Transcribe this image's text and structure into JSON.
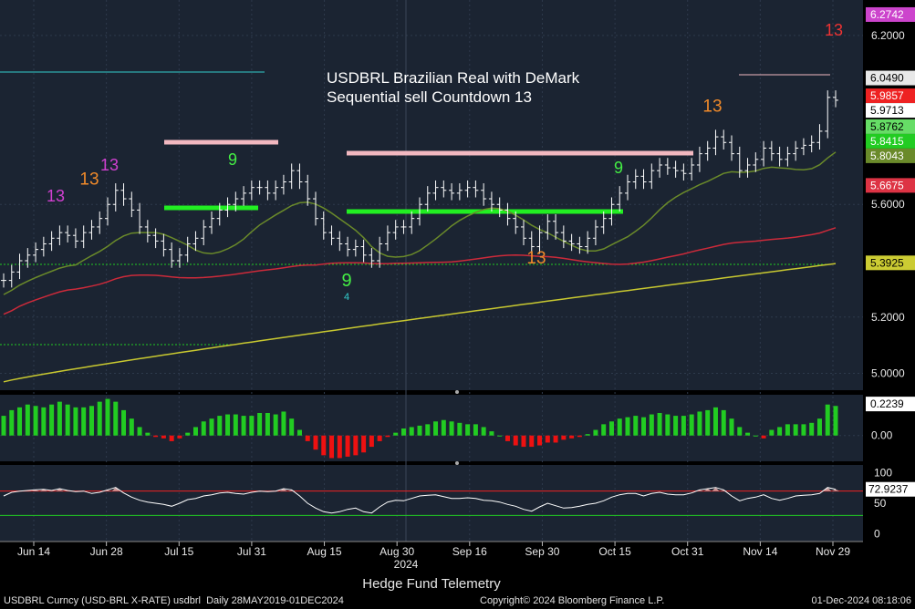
{
  "chart_data": {
    "type": "candlestick",
    "title": "USDBRL Brazilian Real with DeMark\nSequential sell Countdown 13",
    "year_label": "2024",
    "x_tick_labels": [
      "Jun 14",
      "Jun 28",
      "Jul 15",
      "Jul 31",
      "Aug 15",
      "Aug 30",
      "Sep 16",
      "Sep 30",
      "Oct 15",
      "Oct 31",
      "Nov 14",
      "Nov 29"
    ],
    "price_panel": {
      "ylim": [
        4.95,
        6.3
      ],
      "y_ticks": [
        "6.2000",
        "5.6000",
        "5.2000",
        "5.0000"
      ],
      "y_tick_values": [
        6.2,
        5.6,
        5.2,
        5.0
      ],
      "last_price_labels": [
        {
          "text": "6.2742",
          "value": 6.2742,
          "color": "#cc44cc"
        },
        {
          "text": "6.0490",
          "value": 6.049,
          "color": "#e8e8e8"
        },
        {
          "text": "5.9857",
          "value": 5.9857,
          "color": "#ee2222"
        },
        {
          "text": "5.9713",
          "value": 5.9713,
          "color": "#ffffff"
        },
        {
          "text": "5.8762",
          "value": 5.8762,
          "color": "#66dd66"
        },
        {
          "text": "5.8415",
          "value": 5.8415,
          "color": "#22cc22"
        },
        {
          "text": "5.8043",
          "value": 5.8043,
          "color": "#6a8a2a"
        },
        {
          "text": "5.6675",
          "value": 5.6675,
          "color": "#dd3344"
        },
        {
          "text": "5.3925",
          "value": 5.3925,
          "color": "#cccc33"
        }
      ],
      "closes": [
        5.33,
        5.36,
        5.4,
        5.42,
        5.44,
        5.46,
        5.48,
        5.5,
        5.49,
        5.47,
        5.5,
        5.52,
        5.55,
        5.6,
        5.65,
        5.62,
        5.58,
        5.52,
        5.49,
        5.47,
        5.44,
        5.4,
        5.42,
        5.46,
        5.48,
        5.52,
        5.55,
        5.58,
        5.6,
        5.62,
        5.64,
        5.66,
        5.66,
        5.64,
        5.66,
        5.68,
        5.72,
        5.68,
        5.62,
        5.55,
        5.5,
        5.48,
        5.46,
        5.44,
        5.45,
        5.42,
        5.4,
        5.46,
        5.5,
        5.52,
        5.52,
        5.55,
        5.6,
        5.64,
        5.66,
        5.65,
        5.64,
        5.65,
        5.66,
        5.65,
        5.62,
        5.6,
        5.58,
        5.55,
        5.52,
        5.48,
        5.45,
        5.5,
        5.54,
        5.5,
        5.47,
        5.46,
        5.45,
        5.48,
        5.52,
        5.55,
        5.6,
        5.64,
        5.68,
        5.7,
        5.68,
        5.72,
        5.74,
        5.73,
        5.72,
        5.71,
        5.74,
        5.78,
        5.8,
        5.84,
        5.82,
        5.78,
        5.72,
        5.74,
        5.76,
        5.8,
        5.78,
        5.76,
        5.78,
        5.8,
        5.81,
        5.82,
        5.86,
        5.98,
        5.97
      ],
      "demark_counts": [
        {
          "text": "13",
          "color": "#d040d0",
          "value": 5.61
        },
        {
          "text": "13",
          "color": "#f08a2a",
          "value": 5.67
        },
        {
          "text": "13",
          "color": "#d040d0",
          "value": 5.72
        },
        {
          "text": "9",
          "color": "#44ee44",
          "value": 5.74
        },
        {
          "text": "9",
          "color": "#44ee44",
          "value": 5.31
        },
        {
          "text": "4",
          "color": "#33cccc",
          "value": 5.26
        },
        {
          "text": "13",
          "color": "#f08a2a",
          "value": 5.39
        },
        {
          "text": "9",
          "color": "#44ee44",
          "value": 5.71
        },
        {
          "text": "13",
          "color": "#f08a2a",
          "value": 5.93
        },
        {
          "text": "13",
          "color": "#ee3333",
          "value": 6.2
        }
      ]
    },
    "macd_panel": {
      "ylim": [
        -0.17,
        0.27
      ],
      "y_ticks": [
        "0.00"
      ],
      "y_tick_values": [
        0
      ],
      "last_label": {
        "text": "0.2239",
        "value": 0.2239
      },
      "values": [
        0.14,
        0.18,
        0.2,
        0.22,
        0.21,
        0.2,
        0.22,
        0.24,
        0.22,
        0.2,
        0.2,
        0.21,
        0.24,
        0.26,
        0.24,
        0.18,
        0.12,
        0.06,
        0.02,
        -0.01,
        -0.02,
        -0.04,
        -0.02,
        0.02,
        0.06,
        0.1,
        0.12,
        0.14,
        0.15,
        0.15,
        0.14,
        0.14,
        0.16,
        0.16,
        0.15,
        0.17,
        0.12,
        0.04,
        -0.04,
        -0.1,
        -0.14,
        -0.16,
        -0.16,
        -0.15,
        -0.14,
        -0.12,
        -0.08,
        -0.04,
        -0.01,
        0.02,
        0.05,
        0.06,
        0.07,
        0.08,
        0.1,
        0.11,
        0.1,
        0.09,
        0.08,
        0.08,
        0.06,
        0.03,
        0.0,
        -0.04,
        -0.07,
        -0.08,
        -0.08,
        -0.07,
        -0.05,
        -0.05,
        -0.03,
        -0.02,
        -0.01,
        0.01,
        0.04,
        0.08,
        0.1,
        0.12,
        0.13,
        0.14,
        0.13,
        0.15,
        0.16,
        0.15,
        0.14,
        0.14,
        0.15,
        0.17,
        0.18,
        0.2,
        0.18,
        0.12,
        0.06,
        0.02,
        0.0,
        -0.02,
        0.04,
        0.06,
        0.08,
        0.08,
        0.08,
        0.09,
        0.12,
        0.22,
        0.21
      ]
    },
    "rsi_panel": {
      "ylim": [
        -10,
        110
      ],
      "y_ticks": [
        "100",
        "50",
        "0"
      ],
      "y_tick_values": [
        100,
        50,
        0
      ],
      "overbought": 70,
      "oversold": 30,
      "last_label": {
        "text": "72.9237",
        "value": 72.9237
      },
      "values": [
        62,
        68,
        70,
        71,
        72,
        73,
        71,
        74,
        71,
        69,
        70,
        66,
        68,
        72,
        76,
        67,
        60,
        55,
        52,
        50,
        48,
        45,
        50,
        56,
        58,
        62,
        64,
        67,
        68,
        66,
        65,
        68,
        70,
        69,
        70,
        74,
        72,
        62,
        50,
        42,
        36,
        34,
        36,
        40,
        42,
        36,
        34,
        44,
        52,
        55,
        54,
        58,
        62,
        63,
        64,
        61,
        58,
        58,
        59,
        58,
        55,
        54,
        52,
        48,
        45,
        40,
        37,
        44,
        50,
        46,
        42,
        43,
        45,
        48,
        50,
        54,
        60,
        64,
        66,
        66,
        62,
        66,
        68,
        65,
        64,
        64,
        67,
        72,
        74,
        76,
        72,
        62,
        54,
        58,
        60,
        64,
        58,
        55,
        58,
        62,
        63,
        64,
        66,
        76,
        73
      ]
    }
  },
  "footer": {
    "title": "Hedge Fund Telemetry",
    "left": "USDBRL Curncy (USD-BRL X-RATE) usdbrl  Daily 28MAY2019-01DEC2024",
    "copyright": "Copyright© 2024 Bloomberg Finance L.P.",
    "date": "01-Dec-2024 08:18:06"
  },
  "colors": {
    "background": "#1b2432",
    "price": "#ffffff",
    "sma_short": "#6a8a2a",
    "sma_mid": "#cc2a3a",
    "sma_long": "#c8c830",
    "macd_pos": "#22cc22",
    "macd_neg": "#ee1111",
    "rsi_line": "#ffffff",
    "rsi_fill": "#c79b9b"
  }
}
